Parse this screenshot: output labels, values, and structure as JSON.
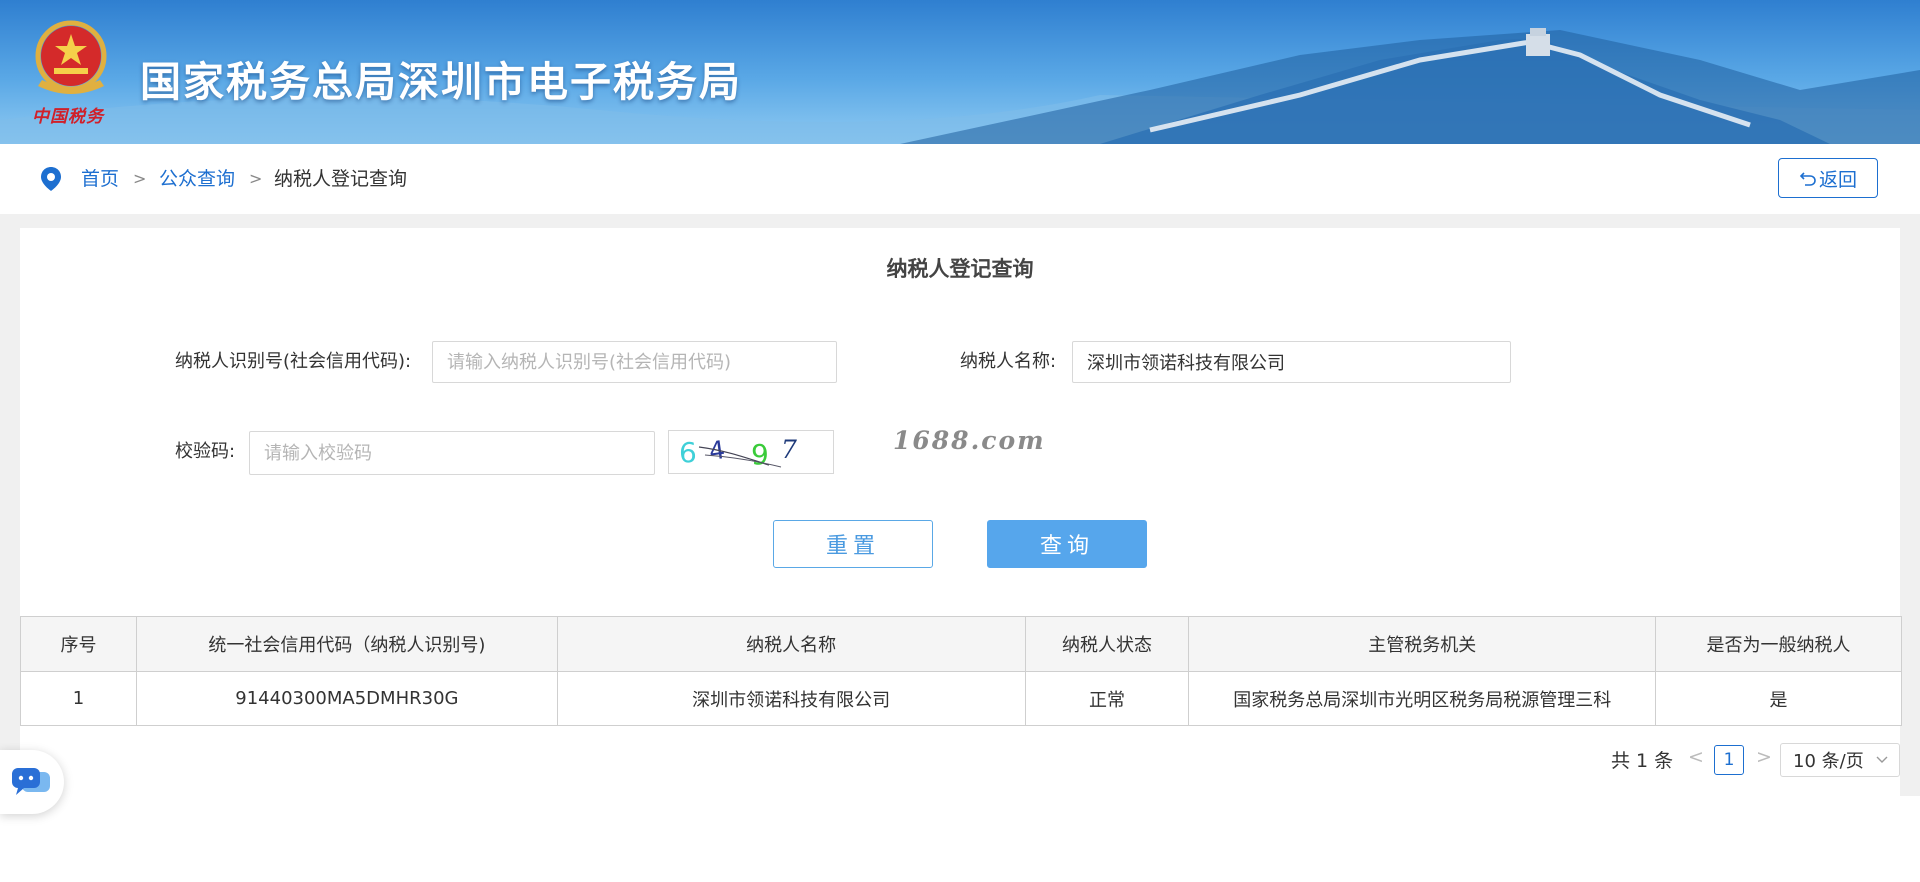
{
  "header": {
    "site_title": "国家税务总局深圳市电子税务局",
    "emblem_caption": "中国税务"
  },
  "breadcrumb": {
    "items": [
      {
        "label": "首页"
      },
      {
        "label": "公众查询"
      },
      {
        "label": "纳税人登记查询"
      }
    ],
    "separator": ">"
  },
  "back_button": {
    "label": "返回"
  },
  "form": {
    "title": "纳税人登记查询",
    "taxpayer_id_label": "纳税人识别号(社会信用代码):",
    "taxpayer_id_value": "",
    "taxpayer_id_placeholder": "请输入纳税人识别号(社会信用代码)",
    "taxpayer_name_label": "纳税人名称:",
    "taxpayer_name_value": "深圳市领诺科技有限公司",
    "verify_code_label": "校验码:",
    "verify_code_value": "",
    "verify_code_placeholder": "请输入校验码",
    "captcha_text": [
      "6",
      "4",
      "9",
      "7"
    ],
    "captcha_colors": [
      "#3fd0d8",
      "#2a3a9a",
      "#3acb3a",
      "#1e3a7a"
    ],
    "watermark": "1688.com",
    "reset_label": "重置",
    "query_label": "查询"
  },
  "table": {
    "columns": [
      "序号",
      "统一社会信用代码（纳税人识别号)",
      "纳税人名称",
      "纳税人状态",
      "主管税务机关",
      "是否为一般纳税人"
    ],
    "rows": [
      [
        "1",
        "91440300MA5DMHR30G",
        "深圳市领诺科技有限公司",
        "正常",
        "国家税务总局深圳市光明区税务局税源管理三科",
        "是"
      ]
    ]
  },
  "pagination": {
    "total": "共 1 条",
    "prev": "<",
    "current_page": "1",
    "next": ">",
    "page_size": "10 条/页"
  },
  "colors": {
    "accent": "#1d6fd0",
    "primary_button": "#56a6ec",
    "banner": "#3d8fd9"
  },
  "icons": {
    "location": "location-pin-icon",
    "back": "undo-arrow-icon",
    "chat": "chat-bubble-icon",
    "dropdown": "chevron-down-icon"
  }
}
